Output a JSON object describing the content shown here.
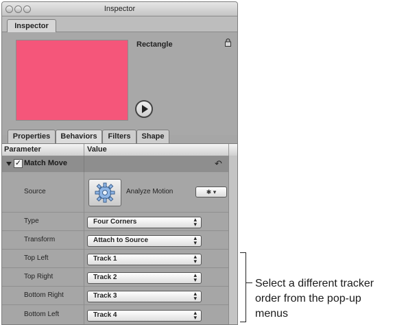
{
  "window": {
    "title": "Inspector",
    "tab": "Inspector"
  },
  "preview": {
    "object_name": "Rectangle",
    "swatch_color": "#f5567a"
  },
  "subtabs": [
    "Properties",
    "Behaviors",
    "Filters",
    "Shape"
  ],
  "active_subtab": "Behaviors",
  "columns": {
    "parameter": "Parameter",
    "value": "Value"
  },
  "group": {
    "label": "Match Move",
    "checked": true
  },
  "source": {
    "label": "Source",
    "button_label": "Analyze Motion",
    "action_icon": "gear-icon"
  },
  "params": [
    {
      "label": "Type",
      "value": "Four Corners"
    },
    {
      "label": "Transform",
      "value": "Attach to Source"
    },
    {
      "label": "Top Left",
      "value": "Track 1"
    },
    {
      "label": "Top Right",
      "value": "Track 2"
    },
    {
      "label": "Bottom Right",
      "value": "Track 3"
    },
    {
      "label": "Bottom Left",
      "value": "Track 4"
    }
  ],
  "callout": {
    "text": "Select a different tracker order from the pop-up menus"
  }
}
